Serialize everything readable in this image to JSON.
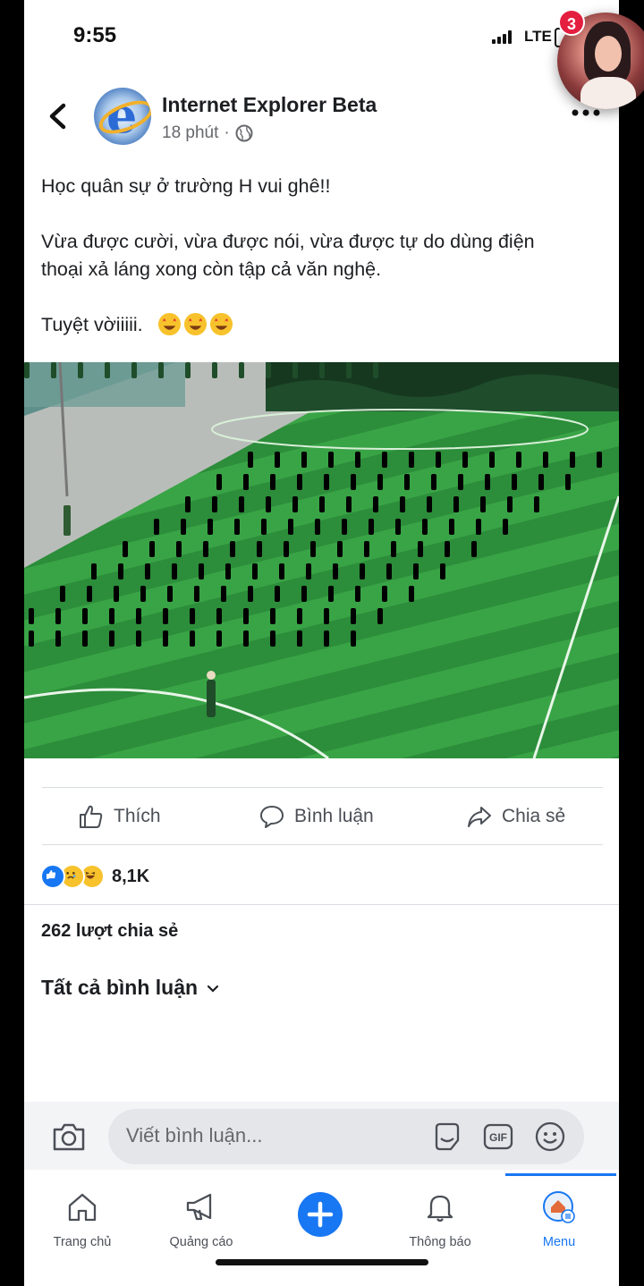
{
  "status_bar": {
    "time": "9:55",
    "network": "LTE"
  },
  "chat_head": {
    "badge_count": "3"
  },
  "post": {
    "page_name": "Internet Explorer Beta",
    "timestamp": "18 phút",
    "meta_separator": "·",
    "text_line1": "Học quân sự ở trường H vui ghê!!",
    "text_line2": "Vừa được cười, vừa được nói, vừa được tự do dùng điện",
    "text_line3": "thoại xả láng xong còn tập cả văn nghệ.",
    "text_line4": "Tuyệt vờiiiii.",
    "emojis": [
      "star-struck-icon",
      "star-struck-icon",
      "star-struck-icon"
    ]
  },
  "actions": {
    "like_label": "Thích",
    "comment_label": "Bình luận",
    "share_label": "Chia sẻ"
  },
  "reactions": {
    "types": [
      "like",
      "sad",
      "haha"
    ],
    "count": "8,1K"
  },
  "shares_text": "262 lượt chia sẻ",
  "all_comments_label": "Tất cả bình luận",
  "comment_bar": {
    "placeholder": "Viết bình luận..."
  },
  "tabs": [
    {
      "label": "Trang chủ"
    },
    {
      "label": "Quảng cáo"
    },
    {
      "label": ""
    },
    {
      "label": "Thông báo"
    },
    {
      "label": "Menu"
    }
  ],
  "colors": {
    "accent": "#1877f2",
    "badge": "#e41e3f",
    "field": "#2f9a3e"
  }
}
